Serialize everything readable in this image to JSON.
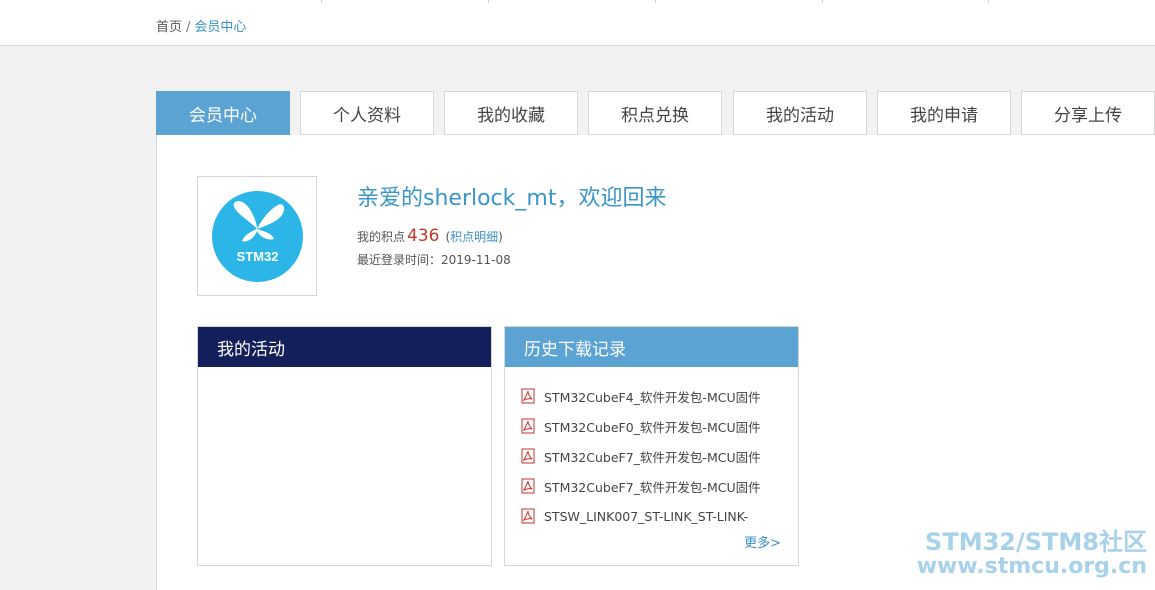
{
  "breadcrumb": {
    "home": "首页",
    "separator": "/",
    "current": "会员中心"
  },
  "tabs": [
    {
      "label": "会员中心",
      "active": true
    },
    {
      "label": "个人资料",
      "active": false
    },
    {
      "label": "我的收藏",
      "active": false
    },
    {
      "label": "积点兑换",
      "active": false
    },
    {
      "label": "我的活动",
      "active": false
    },
    {
      "label": "我的申请",
      "active": false
    },
    {
      "label": "分享上传",
      "active": false
    }
  ],
  "profile": {
    "avatar_icon": "stm32-butterfly-logo-icon",
    "avatar_text": "STM32",
    "welcome": "亲爱的sherlock_mt，欢迎回来",
    "points_label": "我的积点",
    "points_value": "436",
    "paren_open": "(",
    "points_detail_link": "积点明细",
    "paren_close": ")",
    "last_login": "最近登录时间：2019-11-08"
  },
  "activity_box": {
    "title": "我的活动"
  },
  "history_box": {
    "title": "历史下载记录",
    "items": [
      {
        "icon": "pdf-icon",
        "label": "STM32CubeF4_软件开发包-MCU固件"
      },
      {
        "icon": "pdf-icon",
        "label": "STM32CubeF0_软件开发包-MCU固件"
      },
      {
        "icon": "pdf-icon",
        "label": "STM32CubeF7_软件开发包-MCU固件"
      },
      {
        "icon": "pdf-icon",
        "label": "STM32CubeF7_软件开发包-MCU固件"
      },
      {
        "icon": "pdf-icon",
        "label": "STSW_LINK007_ST-LINK_ST-LINK-"
      }
    ],
    "more": "更多>"
  },
  "watermark": {
    "line1": "STM32/STM8社区",
    "line2": "www.stmcu.org.cn"
  },
  "colors": {
    "accent": "#5ba3d2",
    "activity_header": "#131f5b",
    "link": "#3a8fc4",
    "points": "#c0392b",
    "logo_circle": "#2bb6e7"
  }
}
